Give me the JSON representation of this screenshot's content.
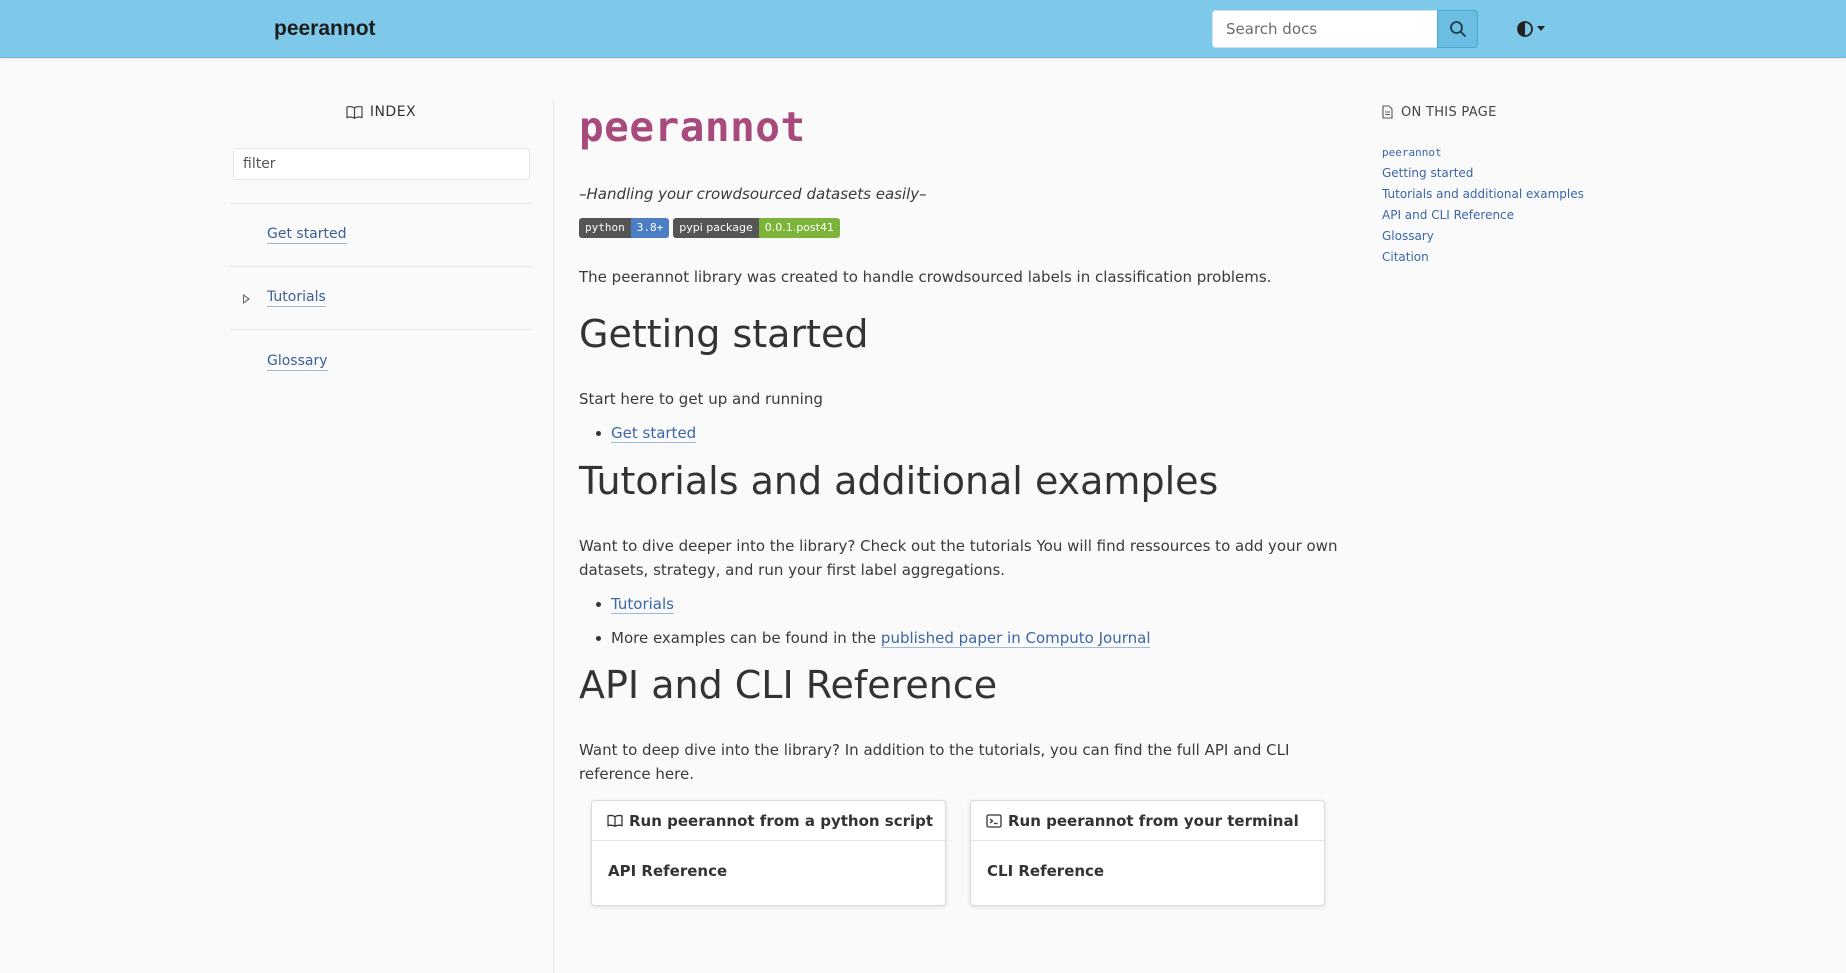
{
  "header": {
    "brand": "peerannot",
    "search_placeholder": "Search docs"
  },
  "sidebar": {
    "title": "INDEX",
    "filter_placeholder": "filter",
    "items": [
      {
        "label": "Get started"
      },
      {
        "label": "Tutorials",
        "expandable": true
      },
      {
        "label": "Glossary"
      }
    ]
  },
  "main": {
    "title": "peerannot",
    "tagline": "–Handling your crowdsourced datasets easily–",
    "badges": [
      {
        "left": "python",
        "right": "3.8+",
        "color": "#4c7ec4"
      },
      {
        "left": "pypi package",
        "right": "0.0.1.post41",
        "color": "#7cb43a"
      }
    ],
    "intro": "The peerannot library was created to handle crowdsourced labels in classification problems.",
    "getting_started": {
      "heading": "Getting started",
      "text": "Start here to get up and running",
      "link": "Get started"
    },
    "tutorials": {
      "heading": "Tutorials and additional examples",
      "text": "Want to dive deeper into the library? Check out the tutorials You will find ressources to add your own datasets, strategy, and run your first label aggregations.",
      "link": "Tutorials",
      "more_prefix": "More examples can be found in the ",
      "more_link": "published paper in Computo Journal"
    },
    "api": {
      "heading": "API and CLI Reference",
      "text": "Want to deep dive into the library? In addition to the tutorials, you can find the full API and CLI reference here.",
      "cards": [
        {
          "head": "Run peerannot from a python script",
          "body": "API Reference",
          "icon": "book-icon"
        },
        {
          "head": "Run peerannot from your terminal",
          "body": "CLI Reference",
          "icon": "terminal-icon"
        }
      ]
    }
  },
  "toc": {
    "title": "ON THIS PAGE",
    "items": [
      "peerannot",
      "Getting started",
      "Tutorials and additional examples",
      "API and CLI Reference",
      "Glossary",
      "Citation"
    ]
  },
  "colors": {
    "header_bg": "#7ec8ea",
    "title_accent": "#a94a7c",
    "link": "#3b66a8"
  }
}
